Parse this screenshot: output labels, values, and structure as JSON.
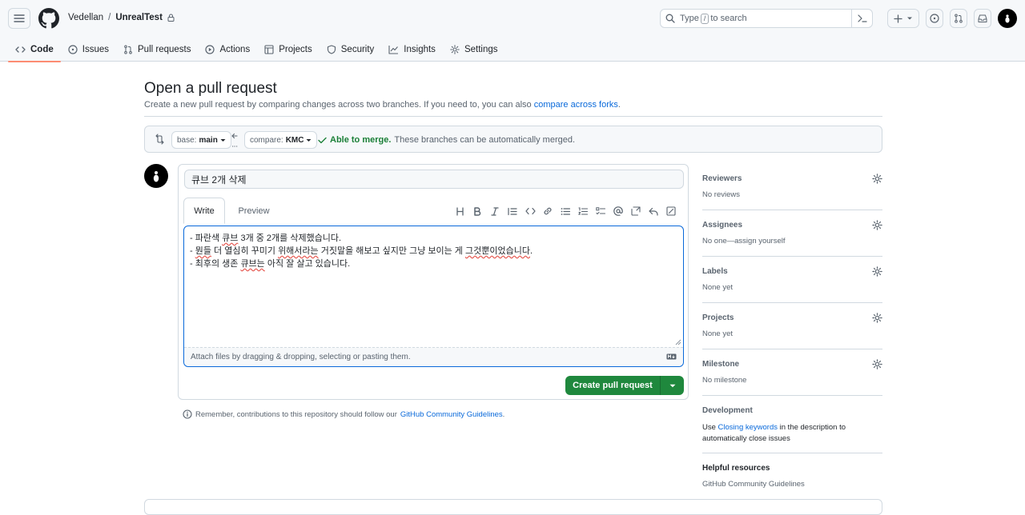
{
  "header": {
    "owner": "Vedellan",
    "separator": "/",
    "repo": "UnrealTest",
    "search_prefix": "Type",
    "search_key": "/",
    "search_suffix": "to search"
  },
  "nav": [
    {
      "label": "Code",
      "icon": "code-icon",
      "active": true
    },
    {
      "label": "Issues",
      "icon": "issue-icon"
    },
    {
      "label": "Pull requests",
      "icon": "pull-request-icon"
    },
    {
      "label": "Actions",
      "icon": "play-icon"
    },
    {
      "label": "Projects",
      "icon": "table-icon"
    },
    {
      "label": "Security",
      "icon": "shield-icon"
    },
    {
      "label": "Insights",
      "icon": "graph-icon"
    },
    {
      "label": "Settings",
      "icon": "gear-icon"
    }
  ],
  "page": {
    "title": "Open a pull request",
    "subtitle": "Create a new pull request by comparing changes across two branches. If you need to, you can also",
    "subtitle_link": "compare across forks",
    "subtitle_end": "."
  },
  "compare": {
    "base_label": "base:",
    "base_value": "main",
    "compare_label": "compare:",
    "compare_value": "KMC",
    "merge_status": "Able to merge.",
    "merge_detail": "These branches can be automatically merged."
  },
  "form": {
    "title_value": "큐브 2개 삭제",
    "tab_write": "Write",
    "tab_preview": "Preview",
    "body_line1_a": "- 파란색 ",
    "body_line1_b": "큐브",
    "body_line1_c": " 3개 중 2개를 삭제했습니다.",
    "body_line2_a": "- ",
    "body_line2_b": "뭔들",
    "body_line2_c": " 더 열심히 꾸미기 ",
    "body_line2_d": "위해서라는",
    "body_line2_e": " 거짓말을 해보고 싶지만 그냥 보이는 게 ",
    "body_line2_f": "그것뿐이었습니다",
    "body_line2_g": ".",
    "body_line3_a": "- 최후의 생존 ",
    "body_line3_b": "큐브는",
    "body_line3_c": " 아직 잘 살고 있습니다.",
    "attach_hint": "Attach files by dragging & dropping, selecting or pasting them.",
    "create_button": "Create pull request"
  },
  "remember": {
    "text": "Remember, contributions to this repository should follow our",
    "link": "GitHub Community Guidelines",
    "end": "."
  },
  "sidebar": {
    "reviewers_title": "Reviewers",
    "reviewers_value": "No reviews",
    "assignees_title": "Assignees",
    "assignees_value": "No one—",
    "assignees_link": "assign yourself",
    "labels_title": "Labels",
    "labels_value": "None yet",
    "projects_title": "Projects",
    "projects_value": "None yet",
    "milestone_title": "Milestone",
    "milestone_value": "No milestone",
    "development_title": "Development",
    "development_text1": "Use",
    "development_link": "Closing keywords",
    "development_text2": "in the description to",
    "development_text3": "automatically close issues",
    "help_title": "Helpful resources",
    "help_link": "GitHub Community Guidelines"
  },
  "colors": {
    "primary_button": "#1f883d",
    "link": "#0969da",
    "active_tab_underline": "#fd8c73",
    "merge_ok": "#1a7f37"
  }
}
